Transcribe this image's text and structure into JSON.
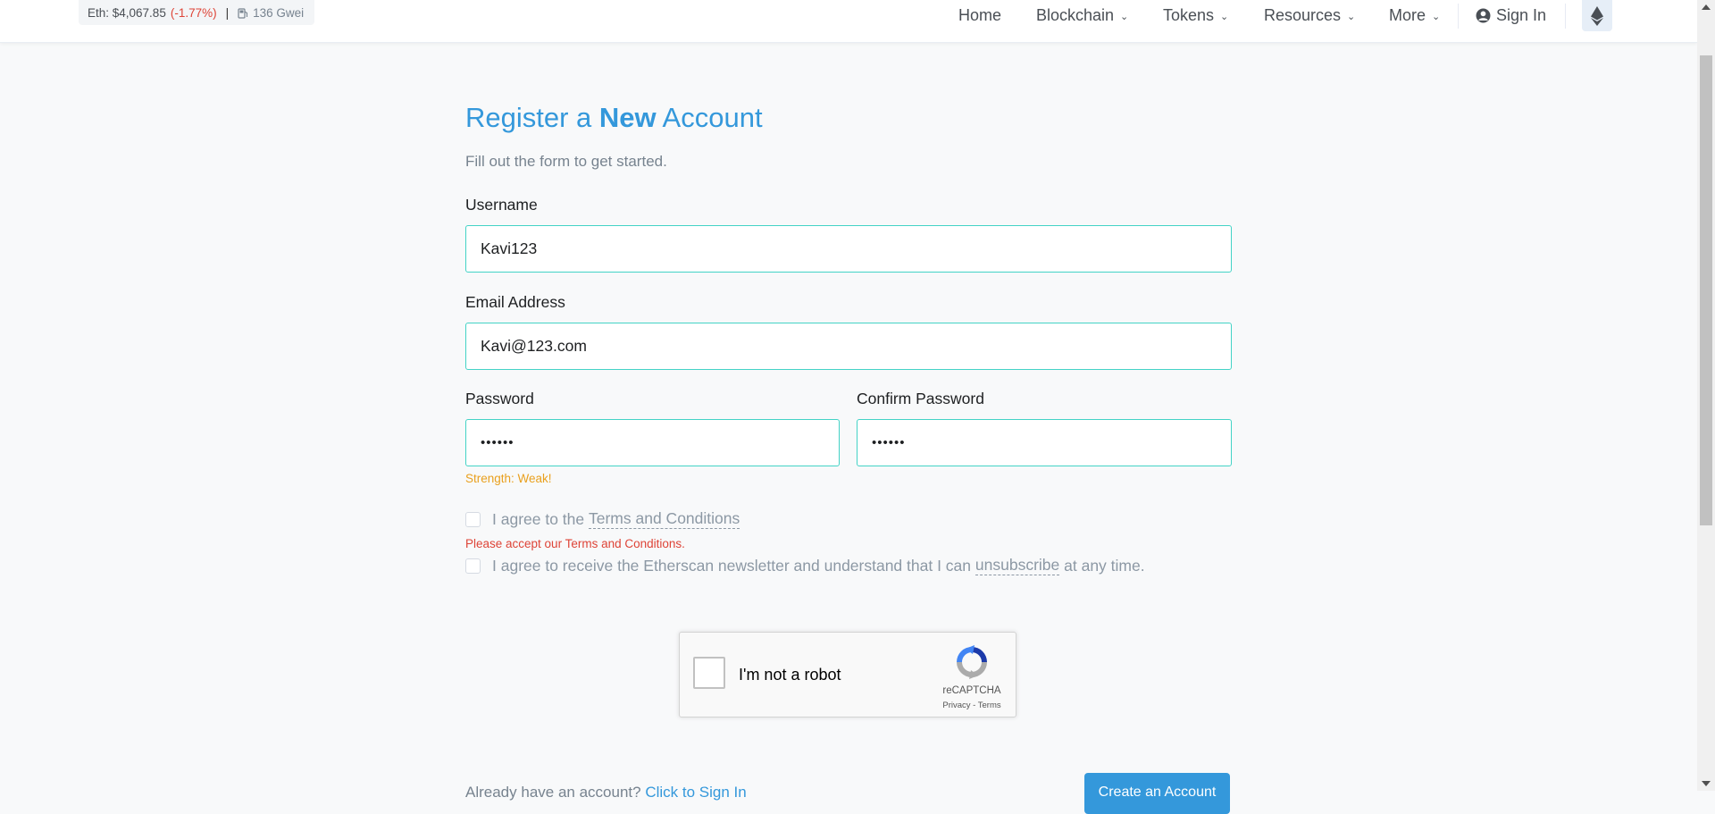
{
  "ticker": {
    "eth_price": "Eth: $4,067.85",
    "eth_change": "(-1.77%)",
    "separator": "|",
    "gas": "136 Gwei"
  },
  "nav": {
    "home": "Home",
    "blockchain": "Blockchain",
    "tokens": "Tokens",
    "resources": "Resources",
    "more": "More",
    "sign_in": "Sign In",
    "chevron": "⌄"
  },
  "form": {
    "title_pre": "Register a ",
    "title_bold": "New",
    "title_post": " Account",
    "subtitle": "Fill out the form to get started.",
    "username_label": "Username",
    "username_value": "Kavi123",
    "email_label": "Email Address",
    "email_value": "Kavi@123.com",
    "password_label": "Password",
    "password_value": "••••••",
    "confirm_label": "Confirm Password",
    "confirm_value": "••••••",
    "strength": "Strength: Weak!",
    "terms_pre": "I agree to the ",
    "terms_link": "Terms and Conditions",
    "terms_error": "Please accept our Terms and Conditions.",
    "newsletter_pre": "I agree to receive the Etherscan newsletter and understand that I can ",
    "newsletter_link": "unsubscribe",
    "newsletter_post": " at any time."
  },
  "recaptcha": {
    "label": "I'm not a robot",
    "brand": "reCAPTCHA",
    "links": "Privacy - Terms"
  },
  "footer": {
    "already": "Already have an account? ",
    "sign_in_link": "Click to Sign In",
    "create_button": "Create an Account"
  },
  "colors": {
    "accent": "#3498db",
    "input_border": "#43d3c6",
    "error": "#de4437",
    "warning": "#e9a01e"
  }
}
